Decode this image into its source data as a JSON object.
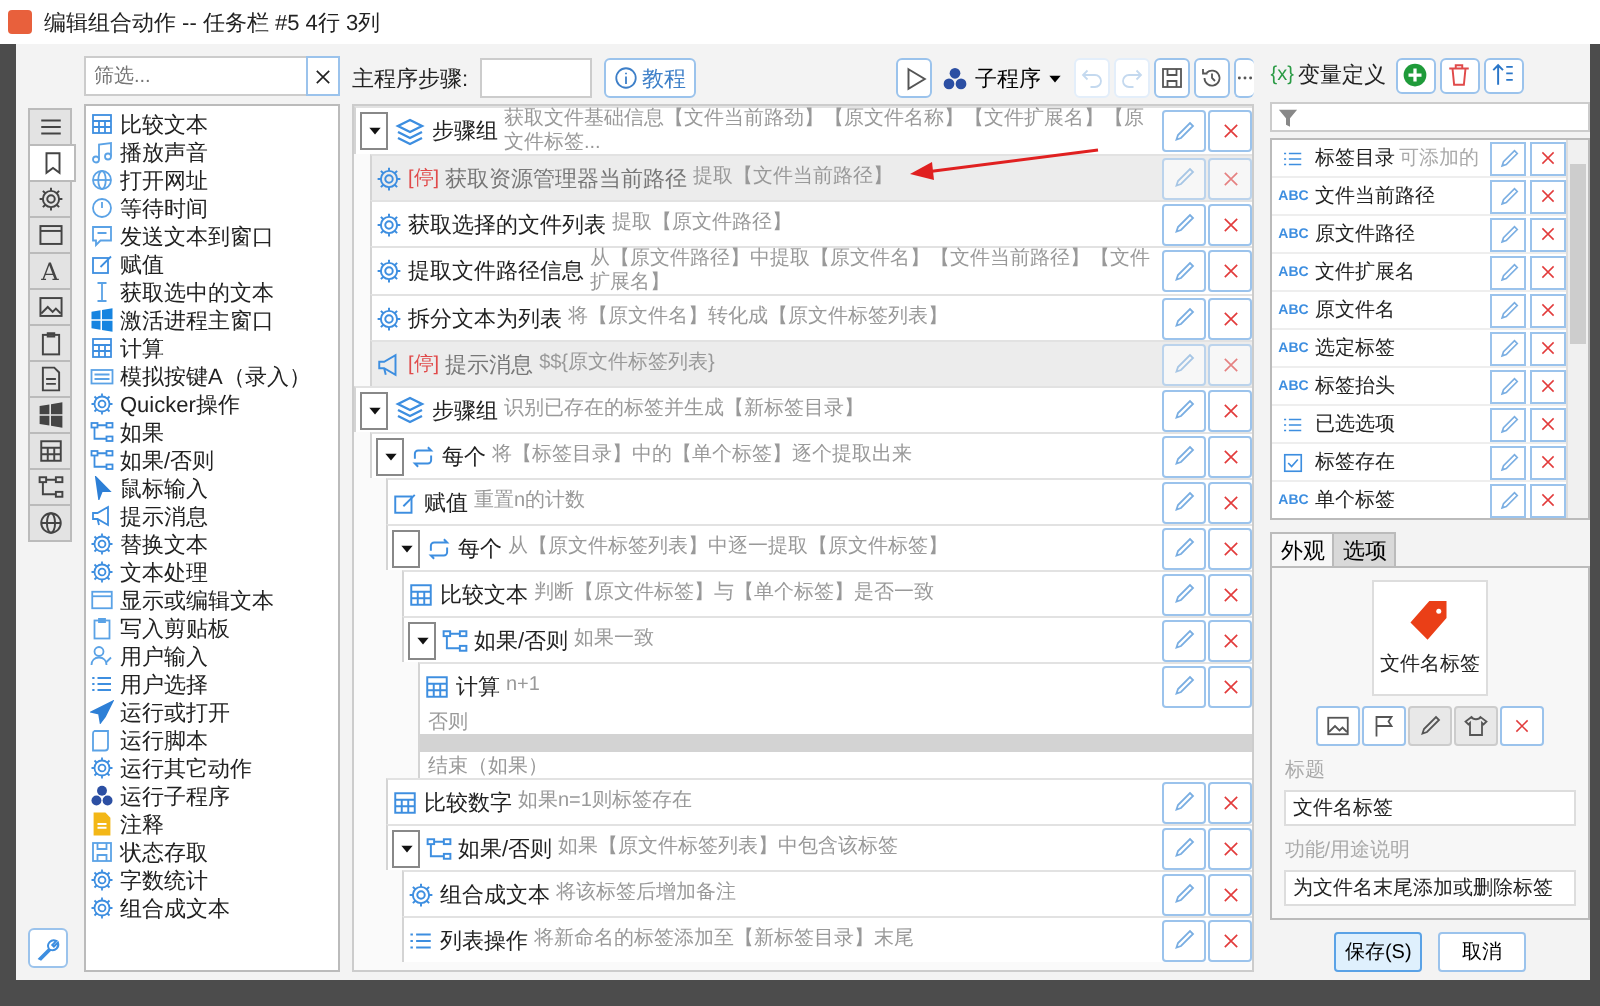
{
  "window": {
    "title": "编辑组合动作 -- 任务栏 #5 4行 3列"
  },
  "side_tabs": [
    {
      "kind": "menu",
      "selected": false
    },
    {
      "kind": "bookmark",
      "selected": true
    },
    {
      "kind": "gear",
      "selected": false
    },
    {
      "kind": "window",
      "selected": false
    },
    {
      "kind": "glyph",
      "glyph": "A",
      "selected": false
    },
    {
      "kind": "image",
      "selected": false
    },
    {
      "kind": "clipboard",
      "selected": false
    },
    {
      "kind": "doc",
      "selected": false
    },
    {
      "kind": "windows",
      "selected": false
    },
    {
      "kind": "calc",
      "selected": false
    },
    {
      "kind": "branch",
      "selected": false
    },
    {
      "kind": "globe",
      "selected": false
    }
  ],
  "filter": {
    "placeholder": "筛选..."
  },
  "actions": [
    {
      "kind": "calc",
      "label": "比较文本"
    },
    {
      "kind": "note",
      "label": "播放声音"
    },
    {
      "kind": "globe",
      "label": "打开网址"
    },
    {
      "kind": "clock",
      "label": "等待时间"
    },
    {
      "kind": "chat",
      "label": "发送文本到窗口"
    },
    {
      "kind": "assign",
      "label": "赋值"
    },
    {
      "kind": "textcursor",
      "label": "获取选中的文本"
    },
    {
      "kind": "windows",
      "label": "激活进程主窗口"
    },
    {
      "kind": "calc",
      "label": "计算"
    },
    {
      "kind": "keyboard",
      "label": "模拟按键A（录入）"
    },
    {
      "kind": "gear",
      "label": "Quicker操作"
    },
    {
      "kind": "branch",
      "label": "如果"
    },
    {
      "kind": "branch",
      "label": "如果/否则"
    },
    {
      "kind": "pointer",
      "label": "鼠标输入"
    },
    {
      "kind": "megaphone",
      "label": "提示消息"
    },
    {
      "kind": "gear",
      "label": "替换文本"
    },
    {
      "kind": "gear",
      "label": "文本处理"
    },
    {
      "kind": "window",
      "label": "显示或编辑文本"
    },
    {
      "kind": "clipboard",
      "label": "写入剪贴板"
    },
    {
      "kind": "user",
      "label": "用户输入"
    },
    {
      "kind": "list",
      "label": "用户选择"
    },
    {
      "kind": "plane",
      "label": "运行或打开"
    },
    {
      "kind": "script",
      "label": "运行脚本"
    },
    {
      "kind": "gear",
      "label": "运行其它动作"
    },
    {
      "kind": "cubes",
      "label": "运行子程序"
    },
    {
      "kind": "note_doc",
      "label": "注释"
    },
    {
      "kind": "save",
      "label": "状态存取"
    },
    {
      "kind": "gear",
      "label": "字数统计"
    },
    {
      "kind": "gear",
      "label": "组合成文本"
    }
  ],
  "toolbar": {
    "label": "主程序步骤:",
    "tutorial": "教程",
    "subprogram": "子程序",
    "undo_disabled": true,
    "redo_disabled": true
  },
  "steps": [
    {
      "kind": "group",
      "expanded": true,
      "disabled": false,
      "name": "步骤组",
      "desc": "获取文件基础信息【文件当前路劲】【原文件名称】【文件扩展名】【原文件标签...",
      "children": [
        {
          "kind": "gear",
          "disabled": true,
          "stop_mark": "[停]",
          "name": "获取资源管理器当前路径",
          "desc": "提取【文件当前路径】"
        },
        {
          "kind": "gear",
          "disabled": false,
          "name": "获取选择的文件列表",
          "desc": "提取【原文件路径】"
        },
        {
          "kind": "gear",
          "disabled": false,
          "name": "提取文件路径信息",
          "desc": "从【原文件路径】中提取【原文件名】【文件当前路径】【文件扩展名】"
        },
        {
          "kind": "gear",
          "disabled": false,
          "name": "拆分文本为列表",
          "desc": "将【原文件名】转化成【原文件标签列表】"
        },
        {
          "kind": "megaphone",
          "disabled": true,
          "stop_mark": "[停]",
          "name": "提示消息",
          "desc": "$${原文件标签列表}"
        }
      ]
    },
    {
      "kind": "group",
      "expanded": true,
      "disabled": false,
      "name": "步骤组",
      "desc": "识别已存在的标签并生成【新标签目录】",
      "children": [
        {
          "kind": "loop",
          "expanded": true,
          "disabled": false,
          "name": "每个",
          "desc": "将【标签目录】中的【单个标签】逐个提取出来",
          "children": [
            {
              "kind": "assign",
              "disabled": false,
              "name": "赋值",
              "desc": "重置n的计数"
            },
            {
              "kind": "loop",
              "expanded": true,
              "disabled": false,
              "name": "每个",
              "desc": "从【原文件标签列表】中逐一提取【原文件标签】",
              "children": [
                {
                  "kind": "calc",
                  "disabled": false,
                  "name": "比较文本",
                  "desc": "判断【原文件标签】与【单个标签】是否一致"
                },
                {
                  "kind": "branch",
                  "expanded": true,
                  "disabled": false,
                  "name": "如果/否则",
                  "desc": "如果一致",
                  "children": [
                    {
                      "kind": "calc",
                      "disabled": false,
                      "name": "计算",
                      "desc": "n+1"
                    }
                  ],
                  "else_label": "否则",
                  "end_label": "结束（如果）"
                }
              ]
            },
            {
              "kind": "calc",
              "disabled": false,
              "name": "比较数字",
              "desc": "如果n=1则标签存在"
            },
            {
              "kind": "branch",
              "expanded": true,
              "disabled": false,
              "name": "如果/否则",
              "desc": "如果【原文件标签列表】中包含该标签",
              "children": [
                {
                  "kind": "gear",
                  "disabled": false,
                  "name": "组合成文本",
                  "desc": "将该标签后增加备注"
                },
                {
                  "kind": "list",
                  "disabled": false,
                  "name": "列表操作",
                  "desc": "将新命名的标签添加至【新标签目录】末尾"
                }
              ]
            }
          ]
        }
      ]
    }
  ],
  "variables": {
    "icon_text": "{x}",
    "title": "变量定义",
    "items": [
      {
        "kind": "list",
        "name": "标签目录",
        "hint": "可添加的"
      },
      {
        "kind": "text",
        "badge": "ABC",
        "name": "文件当前路径"
      },
      {
        "kind": "text",
        "badge": "ABC",
        "name": "原文件路径"
      },
      {
        "kind": "text",
        "badge": "ABC",
        "name": "文件扩展名"
      },
      {
        "kind": "text",
        "badge": "ABC",
        "name": "原文件名"
      },
      {
        "kind": "text",
        "badge": "ABC",
        "name": "选定标签"
      },
      {
        "kind": "text",
        "badge": "ABC",
        "name": "标签抬头"
      },
      {
        "kind": "list",
        "name": "已选选项"
      },
      {
        "kind": "bool",
        "name": "标签存在"
      },
      {
        "kind": "text",
        "badge": "ABC",
        "name": "单个标签"
      }
    ]
  },
  "props_tabs": [
    {
      "label": "外观",
      "selected": true
    },
    {
      "label": "选项",
      "selected": false
    }
  ],
  "appearance": {
    "preview_title": "文件名标签",
    "title_label": "标题",
    "title_value": "文件名标签",
    "desc_label": "功能/用途说明",
    "desc_value": "为文件名末尾添加或删除标签"
  },
  "buttons": [
    {
      "label": "保存(S)",
      "primary": true
    },
    {
      "label": "取消",
      "primary": false
    }
  ]
}
